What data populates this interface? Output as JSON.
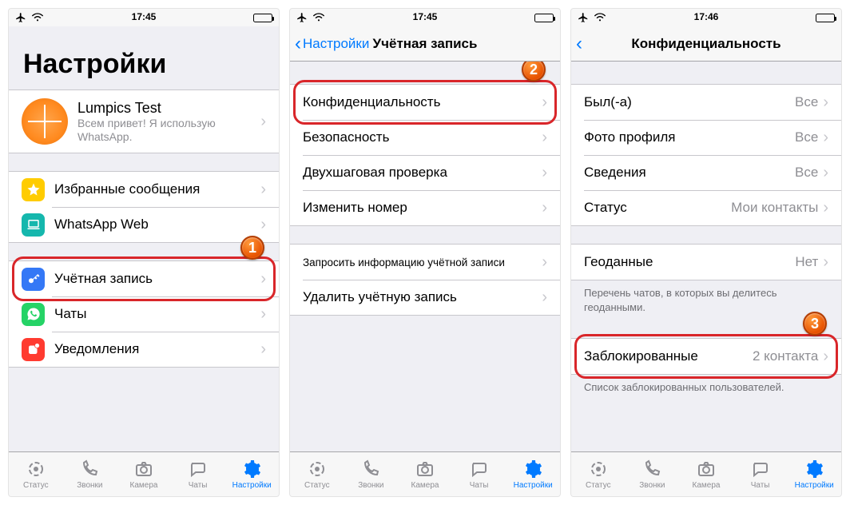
{
  "statusbar": {
    "time1": "17:45",
    "time2": "17:45",
    "time3": "17:46"
  },
  "badges": {
    "b1": "1",
    "b2": "2",
    "b3": "3"
  },
  "screen1": {
    "title": "Настройки",
    "profile": {
      "name": "Lumpics Test",
      "status": "Всем привет! Я использую WhatsApp."
    },
    "rows": {
      "starred": "Избранные сообщения",
      "web": "WhatsApp Web",
      "account": "Учётная запись",
      "chats": "Чаты",
      "notifications": "Уведомления"
    }
  },
  "screen2": {
    "back": "Настройки",
    "title": "Учётная запись",
    "rows": {
      "privacy": "Конфиденциальность",
      "security": "Безопасность",
      "twostep": "Двухшаговая проверка",
      "changenum": "Изменить номер",
      "reqinfo": "Запросить информацию учётной записи",
      "delete": "Удалить учётную запись"
    }
  },
  "screen3": {
    "title": "Конфиденциальность",
    "rows": {
      "lastseen": {
        "label": "Был(-а)",
        "value": "Все"
      },
      "photo": {
        "label": "Фото профиля",
        "value": "Все"
      },
      "about": {
        "label": "Сведения",
        "value": "Все"
      },
      "status": {
        "label": "Статус",
        "value": "Мои контакты"
      },
      "location": {
        "label": "Геоданные",
        "value": "Нет"
      },
      "blocked": {
        "label": "Заблокированные",
        "value": "2 контакта"
      }
    },
    "footer_location": "Перечень чатов, в которых вы делитесь геоданными.",
    "footer_blocked": "Список заблокированных пользователей."
  },
  "tabs": {
    "status": "Статус",
    "calls": "Звонки",
    "camera": "Камера",
    "chats": "Чаты",
    "settings": "Настройки"
  },
  "colors": {
    "icon_star": "#ffcc00",
    "icon_web": "#1ac0c6",
    "icon_key": "#3478f6",
    "icon_chats": "#25d366",
    "icon_notif": "#ff3b30"
  }
}
